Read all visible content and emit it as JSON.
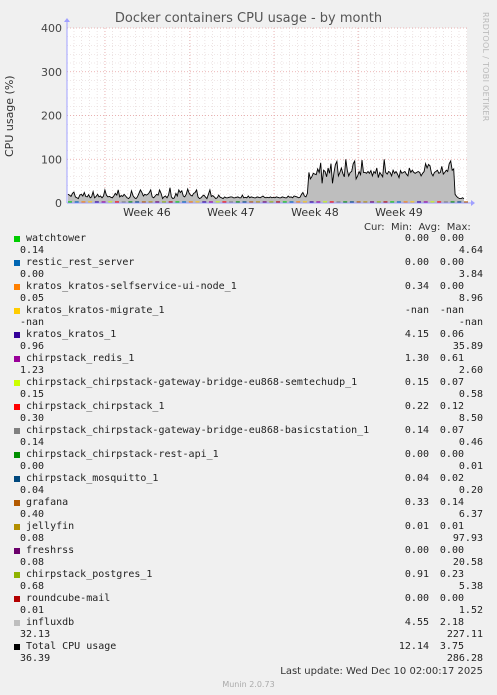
{
  "title": "Docker containers CPU usage - by month",
  "watermark": "RRDTOOL / TOBI OETIKER",
  "legend_header": "Cur:  Min:  Avg:  Max:",
  "last_update": "Last update: Wed Dec 10 02:00:17 2025",
  "munin_version": "Munin 2.0.73",
  "chart_data": {
    "type": "area",
    "ylabel": "CPU usage (%)",
    "ylim": [
      0,
      400
    ],
    "yticks": [
      "0",
      "100",
      "200",
      "300",
      "400"
    ],
    "xticks": [
      "Week 46",
      "Week 47",
      "Week 48",
      "Week 49"
    ],
    "grid": true,
    "legend_placement": "bottom",
    "series_total_shape": [
      20,
      18,
      15,
      22,
      25,
      14,
      12,
      10,
      18,
      20,
      16,
      24,
      15,
      14,
      19,
      12,
      14,
      26,
      12,
      15,
      20,
      14,
      16,
      12,
      16,
      30,
      18,
      14,
      15,
      13,
      12,
      16,
      22,
      18,
      30,
      14,
      17,
      15,
      20,
      16,
      12,
      10,
      14,
      28,
      17,
      12,
      10,
      14,
      22,
      30,
      24,
      16,
      20,
      18,
      20,
      24,
      30,
      14,
      12,
      16,
      20,
      18,
      30,
      22,
      10,
      14,
      16,
      12,
      18,
      35,
      14,
      10,
      12,
      22,
      16,
      30,
      24,
      28,
      16,
      14,
      20,
      32,
      22,
      18,
      16,
      22,
      24,
      30,
      14,
      10,
      12,
      16,
      18,
      14,
      10,
      20,
      30,
      15,
      17,
      14,
      10,
      12,
      18,
      13,
      12,
      10,
      14,
      12,
      12,
      13,
      14,
      14,
      12,
      12,
      13,
      14,
      12,
      12,
      18,
      12,
      13,
      12,
      16,
      12,
      14,
      13,
      12,
      12,
      14,
      13,
      12,
      14,
      16,
      13,
      12,
      13,
      12,
      14,
      12,
      13,
      12,
      14,
      13,
      12,
      12,
      14,
      13,
      12,
      12,
      16,
      13,
      14,
      12,
      16,
      15,
      14,
      12,
      13,
      20,
      24,
      16,
      14,
      22,
      70,
      55,
      60,
      68,
      66,
      65,
      78,
      70,
      92,
      45,
      75,
      72,
      60,
      80,
      68,
      90,
      45,
      70,
      88,
      95,
      62,
      70,
      80,
      68,
      60,
      100,
      75,
      62,
      70,
      72,
      90,
      96,
      55,
      62,
      72,
      65,
      98,
      70,
      70,
      68,
      72,
      68,
      74,
      62,
      72,
      68,
      80,
      58,
      70,
      65,
      60,
      100,
      70,
      66,
      72,
      70,
      62,
      75,
      68,
      72,
      66,
      58,
      74,
      68,
      70,
      72,
      66,
      62,
      80,
      70,
      75,
      70,
      68,
      70,
      72,
      70,
      62,
      68,
      72,
      90,
      80,
      88,
      85,
      68,
      62,
      70,
      72,
      75,
      68,
      70,
      84,
      66,
      70,
      75,
      72,
      90,
      96,
      75,
      78,
      20,
      15,
      12,
      10,
      10,
      12,
      10
    ],
    "series": [
      {
        "name": "watchtower",
        "color": "#00cc00",
        "cur": "0.00",
        "min": "0.00",
        "avg": "0.14",
        "max": "4.64"
      },
      {
        "name": "restic_rest_server",
        "color": "#0066b3",
        "cur": "0.00",
        "min": "0.00",
        "avg": "0.00",
        "max": "3.84"
      },
      {
        "name": "kratos_kratos-selfservice-ui-node_1",
        "color": "#ff8000",
        "cur": "0.34",
        "min": "0.00",
        "avg": "0.05",
        "max": "8.96"
      },
      {
        "name": "kratos_kratos-migrate_1",
        "color": "#ffcc00",
        "cur": "-nan",
        "min": "-nan",
        "avg": "-nan",
        "max": "-nan"
      },
      {
        "name": "kratos_kratos_1",
        "color": "#330099",
        "cur": "4.15",
        "min": "0.06",
        "avg": "0.96",
        "max": "35.89"
      },
      {
        "name": "chirpstack_redis_1",
        "color": "#990099",
        "cur": "1.30",
        "min": "0.61",
        "avg": "1.23",
        "max": "2.60"
      },
      {
        "name": "chirpstack_chirpstack-gateway-bridge-eu868-semtechudp_1",
        "color": "#ccff00",
        "cur": "0.15",
        "min": "0.07",
        "avg": "0.15",
        "max": "0.58"
      },
      {
        "name": "chirpstack_chirpstack_1",
        "color": "#ff0000",
        "cur": "0.22",
        "min": "0.12",
        "avg": "0.30",
        "max": "8.50"
      },
      {
        "name": "chirpstack_chirpstack-gateway-bridge-eu868-basicstation_1",
        "color": "#808080",
        "cur": "0.14",
        "min": "0.07",
        "avg": "0.14",
        "max": "0.46"
      },
      {
        "name": "chirpstack_chirpstack-rest-api_1",
        "color": "#008f00",
        "cur": "0.00",
        "min": "0.00",
        "avg": "0.00",
        "max": "0.01"
      },
      {
        "name": "chirpstack_mosquitto_1",
        "color": "#00487d",
        "cur": "0.04",
        "min": "0.02",
        "avg": "0.04",
        "max": "0.20"
      },
      {
        "name": "grafana",
        "color": "#b35a00",
        "cur": "0.33",
        "min": "0.14",
        "avg": "0.40",
        "max": "6.37"
      },
      {
        "name": "jellyfin",
        "color": "#b38f00",
        "cur": "0.01",
        "min": "0.01",
        "avg": "0.08",
        "max": "97.93"
      },
      {
        "name": "freshrss",
        "color": "#6b006b",
        "cur": "0.00",
        "min": "0.00",
        "avg": "0.08",
        "max": "20.58"
      },
      {
        "name": "chirpstack_postgres_1",
        "color": "#8fb300",
        "cur": "0.91",
        "min": "0.23",
        "avg": "0.68",
        "max": "5.38"
      },
      {
        "name": "roundcube-mail",
        "color": "#b30000",
        "cur": "0.00",
        "min": "0.00",
        "avg": "0.01",
        "max": "1.52"
      },
      {
        "name": "influxdb",
        "color": "#bebebe",
        "cur": "4.55",
        "min": "2.18",
        "avg": "32.13",
        "max": "227.11"
      },
      {
        "name": "Total CPU usage",
        "color": "#000000",
        "cur": "12.14",
        "min": "3.75",
        "avg": "36.39",
        "max": "286.28"
      }
    ]
  }
}
